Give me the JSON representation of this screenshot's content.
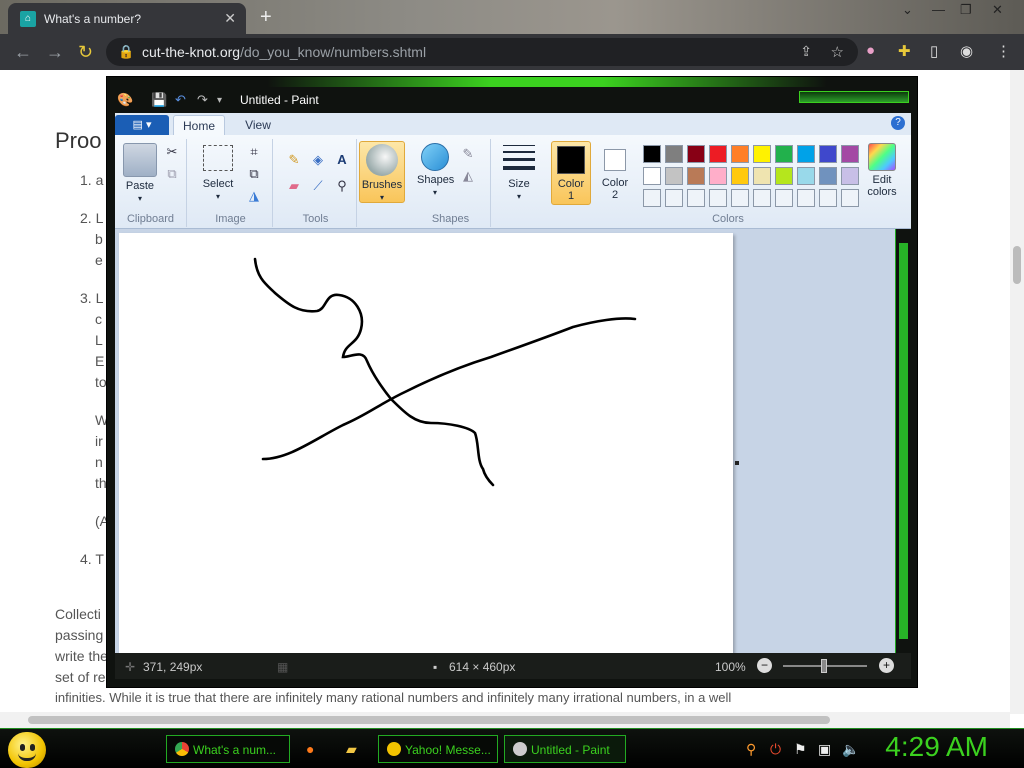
{
  "browser": {
    "tab_title": "What's a number?",
    "tab_favicon": "cut-the-knot-favicon",
    "url_domain": "cut-the-knot.org",
    "url_path": "/do_you_know/numbers.shtml"
  },
  "webpage": {
    "heading": "Proo",
    "list_items": [
      {
        "num": "1.",
        "text": "a"
      },
      {
        "num": "2.",
        "lines": [
          "L",
          "b",
          "e"
        ]
      },
      {
        "num": "3.",
        "lines": [
          "L",
          "c",
          "L",
          "E",
          "to"
        ]
      },
      {
        "lines": [
          "W",
          "ir",
          "n",
          "th"
        ]
      },
      {
        "text": "(A"
      },
      {
        "num": "4.",
        "text": "T"
      }
    ],
    "para_lines": [
      "Collecti",
      "passing",
      "write the",
      "set of re",
      "infinities. While it is true that there are infinitely many rational numbers and infinitely many irrational numbers, in a well"
    ]
  },
  "paint": {
    "window_title": "Untitled - Paint",
    "file_button": "▤ ▾",
    "tabs": [
      {
        "label": "Home",
        "active": true
      },
      {
        "label": "View",
        "active": false
      }
    ],
    "groups": {
      "clipboard": {
        "label": "Clipboard",
        "paste": "Paste"
      },
      "image": {
        "label": "Image",
        "select": "Select"
      },
      "tools": {
        "label": "Tools"
      },
      "brushes": {
        "label": "Brushes"
      },
      "shapes": {
        "label": "Shapes",
        "shapes_btn": "Shapes"
      },
      "size": {
        "label": "Size"
      },
      "colors": {
        "label": "Colors",
        "color1_line1": "Color",
        "color1_line2": "1",
        "color2_line1": "Color",
        "color2_line2": "2",
        "edit_line1": "Edit",
        "edit_line2": "colors",
        "color1": "#000000",
        "color2": "#ffffff",
        "palette_row1": [
          "#000000",
          "#7f7f7f",
          "#880015",
          "#ed1c24",
          "#ff7f27",
          "#fff200",
          "#22b14c",
          "#00a2e8",
          "#3f48cc",
          "#a349a4"
        ],
        "palette_row2": [
          "#ffffff",
          "#c3c3c3",
          "#b97a57",
          "#ffaec9",
          "#ffc90e",
          "#efe4b0",
          "#b5e61d",
          "#99d9ea",
          "#7092be",
          "#c8bfe7"
        ]
      }
    },
    "status": {
      "cursor_pos": "371, 249px",
      "canvas_size": "614 × 460px",
      "zoom": "100%"
    }
  },
  "taskbar": {
    "items": [
      {
        "label": "What's a num...",
        "icon": "chrome-icon"
      },
      {
        "label": "Yahoo! Messe...",
        "icon": "yahoo-messenger-icon"
      },
      {
        "label": "Untitled - Paint",
        "icon": "paint-icon"
      }
    ],
    "clock": "4:29 AM"
  }
}
